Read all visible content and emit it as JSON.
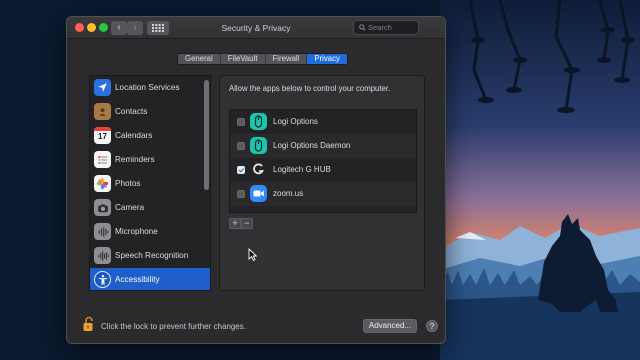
{
  "window": {
    "title": "Security & Privacy",
    "back_glyph": "‹",
    "forward_glyph": "›",
    "grid_icon": "grid-icon",
    "search_placeholder": "Search"
  },
  "tabs": [
    {
      "label": "General",
      "active": false
    },
    {
      "label": "FileVault",
      "active": false
    },
    {
      "label": "Firewall",
      "active": false
    },
    {
      "label": "Privacy",
      "active": true
    }
  ],
  "sidebar": {
    "items": [
      {
        "label": "Location Services",
        "icon": "location-arrow-icon",
        "selected": false
      },
      {
        "label": "Contacts",
        "icon": "contacts-book-icon",
        "selected": false
      },
      {
        "label": "Calendars",
        "icon": "calendar-icon",
        "selected": false
      },
      {
        "label": "Reminders",
        "icon": "reminders-list-icon",
        "selected": false
      },
      {
        "label": "Photos",
        "icon": "photos-flower-icon",
        "selected": false
      },
      {
        "label": "Camera",
        "icon": "camera-icon",
        "selected": false
      },
      {
        "label": "Microphone",
        "icon": "microphone-icon",
        "selected": false
      },
      {
        "label": "Speech Recognition",
        "icon": "speech-waveform-icon",
        "selected": false
      },
      {
        "label": "Accessibility",
        "icon": "accessibility-icon",
        "selected": true
      }
    ],
    "calendar_icon_day": "17"
  },
  "pane": {
    "heading": "Allow the apps below to control your computer.",
    "apps": [
      {
        "label": "Logi Options",
        "checked": false,
        "icon": "logi-options-icon"
      },
      {
        "label": "Logi Options Daemon",
        "checked": false,
        "icon": "logi-options-icon"
      },
      {
        "label": "Logitech G HUB",
        "checked": true,
        "icon": "logitech-g-icon"
      },
      {
        "label": "zoom.us",
        "checked": false,
        "icon": "zoom-camera-icon"
      }
    ],
    "add_label": "+",
    "remove_label": "−"
  },
  "footer": {
    "lock_text": "Click the lock to prevent further changes.",
    "advanced_label": "Advanced...",
    "help_label": "?"
  },
  "colors": {
    "accent": "#1f6ddc",
    "selected_row": "#1e5fcc",
    "window_bg": "#2b2b2e"
  }
}
